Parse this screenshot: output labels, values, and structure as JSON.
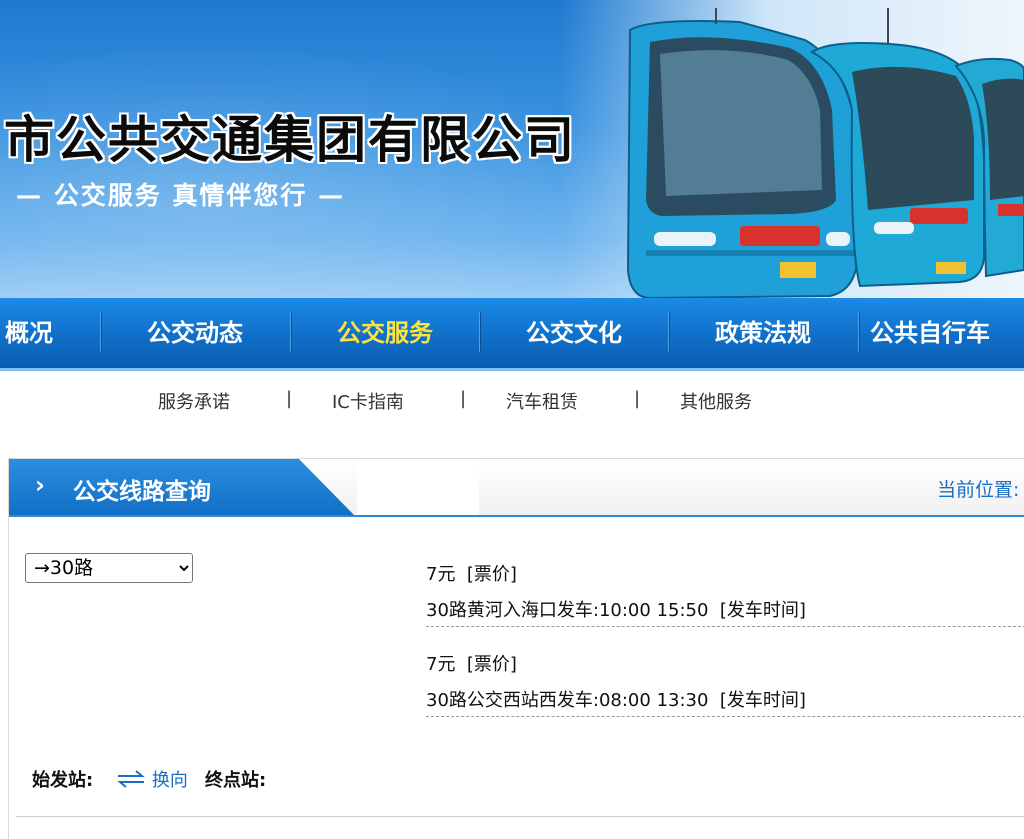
{
  "banner": {
    "title": "市公共交通集团有限公司",
    "slogan": "— 公交服务 真情伴您行 —"
  },
  "main_nav": [
    {
      "label": "概况",
      "active": false
    },
    {
      "label": "公交动态",
      "active": false
    },
    {
      "label": "公交服务",
      "active": true
    },
    {
      "label": "公交文化",
      "active": false
    },
    {
      "label": "政策法规",
      "active": false
    },
    {
      "label": "公共自行车",
      "active": false
    }
  ],
  "sub_nav": {
    "items": [
      "服务承诺",
      "IC卡指南",
      "汽车租赁",
      "其他服务"
    ],
    "separator": "|"
  },
  "panel": {
    "chevron": "›",
    "title": "公交线路查询",
    "breadcrumb": "当前位置:"
  },
  "route_select": {
    "selected": "→30路"
  },
  "route_info": [
    {
      "fare": "7元",
      "fare_tag": "[票价]",
      "departure": "30路黄河入海口发车:10:00 15:50",
      "departure_tag": "[发车时间]"
    },
    {
      "fare": "7元",
      "fare_tag": "[票价]",
      "departure": "30路公交西站西发车:08:00 13:30",
      "departure_tag": "[发车时间]"
    }
  ],
  "stations": {
    "start_label": "始发站:",
    "swap_label": "换向",
    "end_label": "终点站:"
  },
  "colors": {
    "nav_bg": "#0f6fc8",
    "nav_active": "#ffe23a",
    "link_blue": "#1a6fc4"
  }
}
